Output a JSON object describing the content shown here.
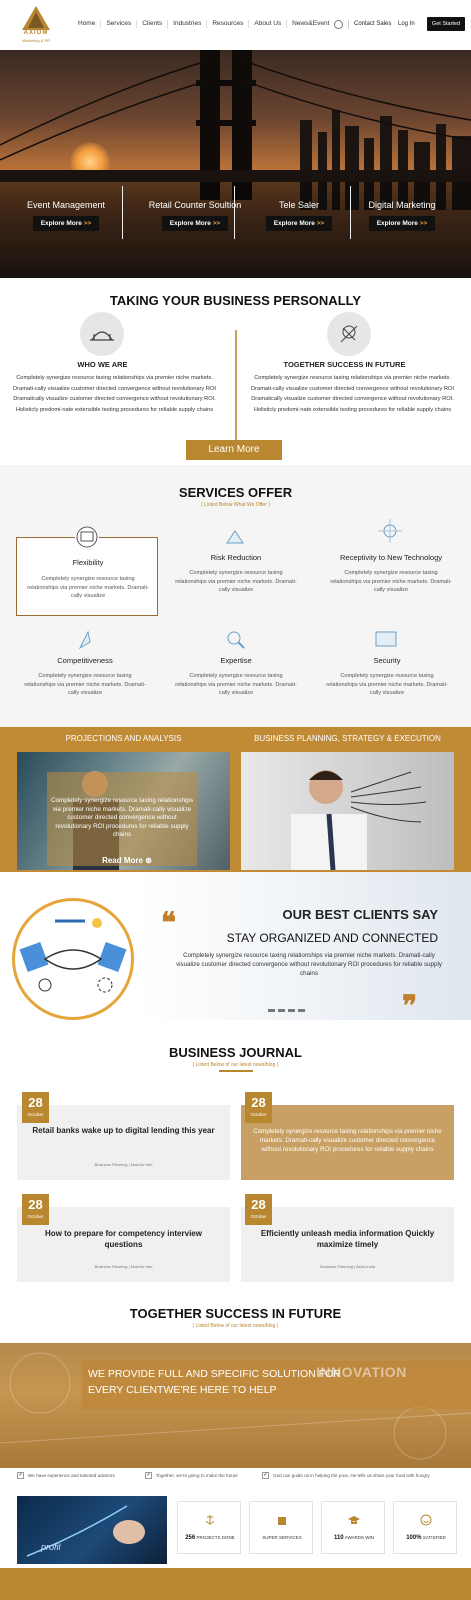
{
  "header": {
    "logo_word": "AXIOM",
    "logo_sub": "Marketing & PR",
    "nav": [
      "Home",
      "Services",
      "Clients",
      "Industries",
      "Resources",
      "About Us",
      "News&Event"
    ],
    "contact_sales": "Contact Sales",
    "login": "Log In",
    "get_started": "Get Started"
  },
  "hero": {
    "items": [
      {
        "title": "Event Management",
        "cta": "Explore More"
      },
      {
        "title": "Retail Counter Soultion",
        "cta": "Explore More"
      },
      {
        "title": "Tele Saler",
        "cta": "Explore More"
      },
      {
        "title": "Digital Marketing",
        "cta": "Explore More"
      }
    ],
    "arrow": ">>"
  },
  "about": {
    "title": "TAKING YOUR BUSINESS PERSONALLY",
    "left_title": "WHO WE ARE",
    "left_text": "Completely synergize resource taxing relationships via premier niche markets. Dramati-cally visualize customer directed convergence without revolutionary ROI Dramatically visualize customer directed convergence without revolutionary ROI. Holisticly predomi-nate extensible testing procedures for reliable supply chains",
    "right_title": "TOGETHER SUCCESS IN FUTURE",
    "right_text": "Completely synergize resource taxing relationships via premier niche markets. Dramati-cally visualize customer directed convergence without revolutionary ROI Dramatically visualize customer directed convergence without revolutionary ROI. Holisticly predomi-nate extensible testing procedures for reliable supply chains",
    "learn_more": "Learn More"
  },
  "services": {
    "title": "SERVICES OFFER",
    "subtitle": "( Listed Below What We Offer )",
    "items": [
      {
        "title": "Flexibility",
        "text": "Completely synergize resource taxing relationships via premier niche markets. Dramati-cally visualize"
      },
      {
        "title": "Risk Reduction",
        "text": "Completely synergize resource taxing relationships via premier niche markets. Dramati-cally visualize"
      },
      {
        "title": "Receptivity to New Technology",
        "text": "Completely synergize resource taxing relationships via premier niche markets. Dramati-cally visualize"
      },
      {
        "title": "Competitiveness",
        "text": "Completely synergize resource taxing relationships via premier niche markets. Dramati-cally visualize"
      },
      {
        "title": "Expertise",
        "text": "Completely synergize resource taxing relationships via premier niche markets. Dramati-cally visualize"
      },
      {
        "title": "Security",
        "text": "Completely synergize resource taxing relationships via premier niche markets. Dramati-cally visualize"
      }
    ]
  },
  "projections": {
    "left_heading": "PROJECTIONS AND ANALYSIS",
    "right_heading": "BUSINESS PLANNING, STRATEGY & EXECUTION",
    "overlay_text": "Completely synergize resource taxing relationships via premier niche markets. Dramati-cally visualize customer directed convergence without revolutionary ROI procedures for reliable supply chains",
    "read_more": "Read More"
  },
  "clients": {
    "heading": "OUR BEST CLIENTS SAY",
    "subheading": "STAY ORGANIZED AND CONNECTED",
    "text": "Completely synergize resource taxing relationships via premier niche markets. Dramati-cally visualize customer directed convergence without revolutionary ROI procedures for reliable supply chains"
  },
  "journal": {
    "title": "BUSINESS JOURNAL",
    "subtitle": "( Listed Below of our latest news/blog )",
    "cards": [
      {
        "day": "28",
        "month": "October",
        "title": "Retail banks wake up to digital lending this year",
        "meta": "Business Planning  |  Mukhtu Hari"
      },
      {
        "day": "28",
        "month": "October",
        "title": "Completely synergize resource taxing relationships via premier niche markets. Dramati-cally visualize customer directed convergence without revolutionary ROI procedures for reliable supply chains",
        "meta": ""
      },
      {
        "day": "28",
        "month": "October",
        "title": "How to prepare for competency interview questions",
        "meta": "Business Planning  |  Mukhtu Hari"
      },
      {
        "day": "28",
        "month": "October",
        "title": "Efficiently unleash media information Quickly maximize timely",
        "meta": "Business Planning  |  Asha India"
      }
    ]
  },
  "future": {
    "title": "TOGETHER SUCCESS IN FUTURE",
    "subtitle": "( Listed Below of our latest news/blog )",
    "banner_line1": "WE PROVIDE FULL AND SPECIFIC SOLUTION FOR",
    "banner_line2": "EVERY CLIENTWE'RE HERE TO HELP",
    "banner_word": "INNOVATION"
  },
  "checks": [
    "We have experience and talented advisors",
    "Together, we're going to make the future",
    "God can guide us in helping the poor, He tells us share your food with hungry"
  ],
  "stats": [
    {
      "icon": "anchor-icon",
      "value": "256",
      "label": "PROJECTS DONE"
    },
    {
      "icon": "building-icon",
      "value": "",
      "label": "SUPER SERVICES"
    },
    {
      "icon": "graduation-cap-icon",
      "value": "110",
      "label": "AWARDS WIN"
    },
    {
      "icon": "smile-icon",
      "value": "100%",
      "label": "SATISFIED"
    }
  ],
  "photo_caption": "profil",
  "colors": {
    "gold": "#b8872f",
    "dark": "#111111"
  }
}
